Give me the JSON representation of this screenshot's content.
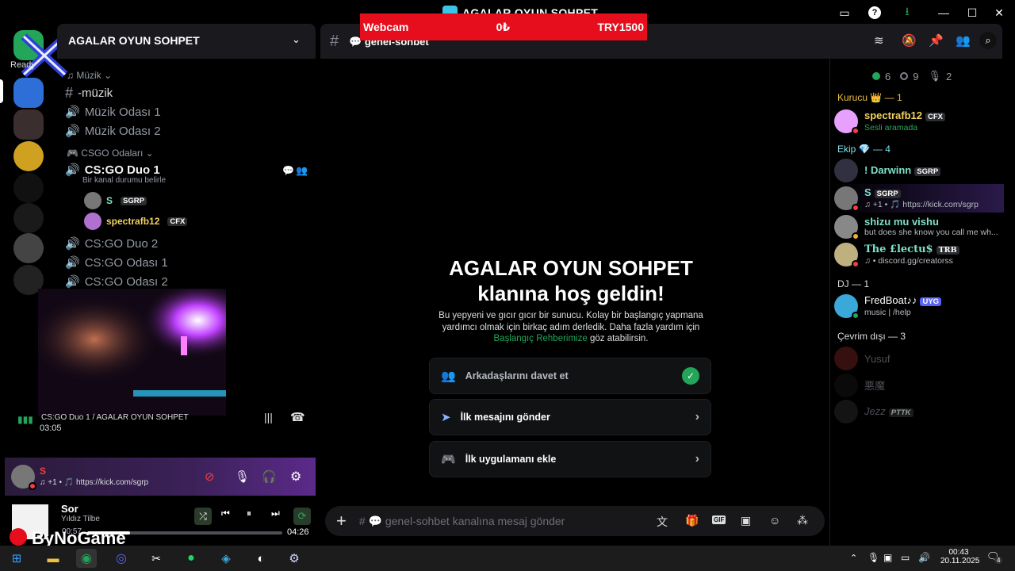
{
  "window": {
    "title": "AGALAR OYUN SOHPET"
  },
  "overlay": {
    "label": "Webcam",
    "amount": "0₺",
    "goal": "TRY1500"
  },
  "server": {
    "name": "AGALAR OYUN SOHPET"
  },
  "rail": {
    "top_label": "Ready"
  },
  "categories": {
    "music": "Müzik",
    "csgo": "CSGO Odaları"
  },
  "channels": {
    "music_text": "-müzik",
    "music_room1": "Müzik Odası 1",
    "music_room2": "Müzik Odası 2",
    "duo1": "CS:GO Duo 1",
    "duo1_status": "Bir kanal durumu belirle",
    "duo2": "CS:GO Duo 2",
    "room1": "CS:GO Odası 1",
    "room2": "CS:GO Odası 2"
  },
  "voice_users": [
    {
      "name": "S",
      "tag": "SGRP"
    },
    {
      "name": "spectrafb12",
      "tag": "CFX"
    }
  ],
  "voice_status": {
    "channel": "CS:GO Duo 1 / AGALAR OYUN SOHPET",
    "time": "03:05"
  },
  "user_panel": {
    "name": "S",
    "status": "♫ +1 • 🎵 https://kick.com/sgrp"
  },
  "player": {
    "title": "Sor",
    "artist": "Yıldız Tilbe",
    "elapsed": "00:57",
    "duration": "04:26",
    "progress": 0.22
  },
  "watermark": "ByNoGame",
  "channel_header": {
    "name": "genel-sohbet"
  },
  "welcome": {
    "title1": "AGALAR OYUN SOHPET",
    "title2": "klanına hoş geldin!",
    "text": "Bu yepyeni ve gıcır gıcır bir sunucu. Kolay bir başlangıç yapmana yardımcı olmak için birkaç adım derledik. Daha fazla yardım için",
    "link": "Başlangıç Rehberimize",
    "text_end": "göz atabilirsin."
  },
  "cards": [
    {
      "label": "Arkadaşlarını davet et",
      "done": true
    },
    {
      "label": "İlk mesajını gönder",
      "done": false
    },
    {
      "label": "İlk uygulamanı ekle",
      "done": false
    }
  ],
  "composer": {
    "placeholder": "# 💬 genel-sohbet kanalına mesaj gönder"
  },
  "member_counts": {
    "online": "6",
    "offline": "9",
    "voice": "2"
  },
  "roles": {
    "founder": "Kurucu 👑 — 1",
    "team": "Ekip 💎 — 4",
    "dj": "DJ — 1",
    "offline": "Çevrim dışı — 3"
  },
  "members": [
    {
      "name": "spectrafb12",
      "tag": "CFX",
      "sub": "Sesli aramada",
      "color": "#e8a0ff",
      "name_color": "#f0d060"
    },
    {
      "name": "! Darwinn",
      "tag": "SGRP",
      "sub": "",
      "color": "#303040",
      "name_color": "#7ee0c8"
    },
    {
      "name": "S",
      "tag": "SGRP",
      "sub": "♫ +1 • 🎵 https://kick.com/sgrp",
      "color": "#777",
      "name_color": "#7ee0c8"
    },
    {
      "name": "shizu mu vishu",
      "tag": "",
      "sub": "but does she know you call me wh...",
      "color": "#888",
      "name_color": "#7ee0c8"
    },
    {
      "name": "The £lectu$",
      "tag": "TRB",
      "sub": "♫ • discord.gg/creatorss",
      "color": "#c0b080",
      "name_color": "#7ee0c8"
    },
    {
      "name": "FredBoat♪♪",
      "tag": "UYG",
      "sub": "music | /help",
      "color": "#3aa8d8",
      "name_color": "#fff"
    },
    {
      "name": "Yusuf",
      "tag": "",
      "sub": "",
      "color": "#5a1a1a",
      "name_color": "#80848e"
    },
    {
      "name": "悪魔",
      "tag": "",
      "sub": "",
      "color": "#111",
      "name_color": "#80848e"
    },
    {
      "name": "Jezz",
      "tag": "PTTK",
      "sub": "",
      "color": "#222",
      "name_color": "#80848e"
    }
  ],
  "taskbar": {
    "time": "00:43",
    "date": "20.11.2025",
    "notif": "4"
  },
  "colors": {
    "accent": "#5865f2",
    "green": "#23a55a",
    "red": "#e60d1c",
    "bg": "#000000"
  }
}
